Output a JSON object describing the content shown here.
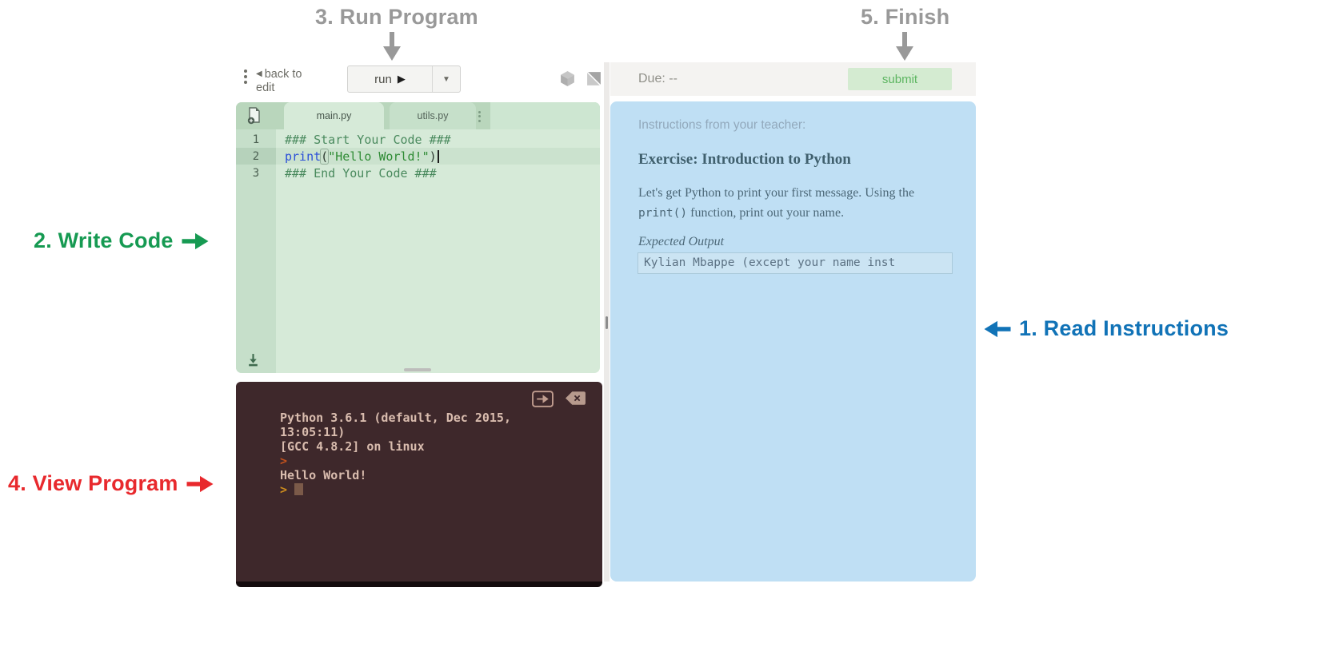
{
  "annotations": {
    "step3": {
      "label": "3. Run Program",
      "color": "#999999"
    },
    "step5": {
      "label": "5. Finish",
      "color": "#999999"
    },
    "step2": {
      "label": "2. Write Code",
      "color": "#169a52"
    },
    "step4": {
      "label": "4. View Program",
      "color": "#e8292d"
    },
    "step1": {
      "label": "1. Read Instructions",
      "color": "#1173b7"
    }
  },
  "ide": {
    "toolbar": {
      "back_arrow": "◀",
      "back_line1": "back to",
      "back_line2": "edit",
      "run_label": "run",
      "run_play": "▶",
      "run_caret": "▼"
    },
    "editor": {
      "tabs": {
        "main": "main.py",
        "utils": "utils.py"
      },
      "lines": {
        "l1": {
          "number": "1",
          "text": "### Start Your Code ###"
        },
        "l2": {
          "number": "2",
          "kw": "print",
          "open": "(",
          "str": "\"Hello World!\"",
          "close": ")"
        },
        "l3": {
          "number": "3",
          "text": "### End Your Code ###"
        }
      }
    },
    "console": {
      "line1": "Python 3.6.1 (default, Dec 2015,",
      "line2": "13:05:11)",
      "line3": "[GCC 4.8.2] on linux",
      "prompt1": ">",
      "line4": "Hello World!",
      "prompt2": ">"
    }
  },
  "assignment": {
    "due_label": "Due: --",
    "submit_label": "submit",
    "instructions_header": "Instructions from your teacher:",
    "exercise_title": "Exercise: Introduction to Python",
    "body_line1": "Let's get Python to print your first message. Using the",
    "body_code": "print()",
    "body_line2_rest": " function, print out your name.",
    "expected_output_label": "Expected Output",
    "expected_output_value": "Kylian Mbappe (except your name inst"
  },
  "colors": {
    "annotation_gray": "#999999",
    "annotation_green": "#169a52",
    "annotation_red": "#e8292d",
    "annotation_blue": "#1173b7",
    "editor_bg": "#d6ead8",
    "editor_tabbar": "#b9d6bc",
    "console_bg": "#3e282b",
    "console_text": "#d9bcae",
    "console_prompt_red": "#c0511d",
    "console_prompt_yellow": "#cd8c1d",
    "instructions_bg": "#bfdff4",
    "submit_green": "#5cb560",
    "syntax_keyword": "#2b4fd8",
    "syntax_string": "#2e8b34",
    "syntax_comment": "#4a8a5e"
  }
}
